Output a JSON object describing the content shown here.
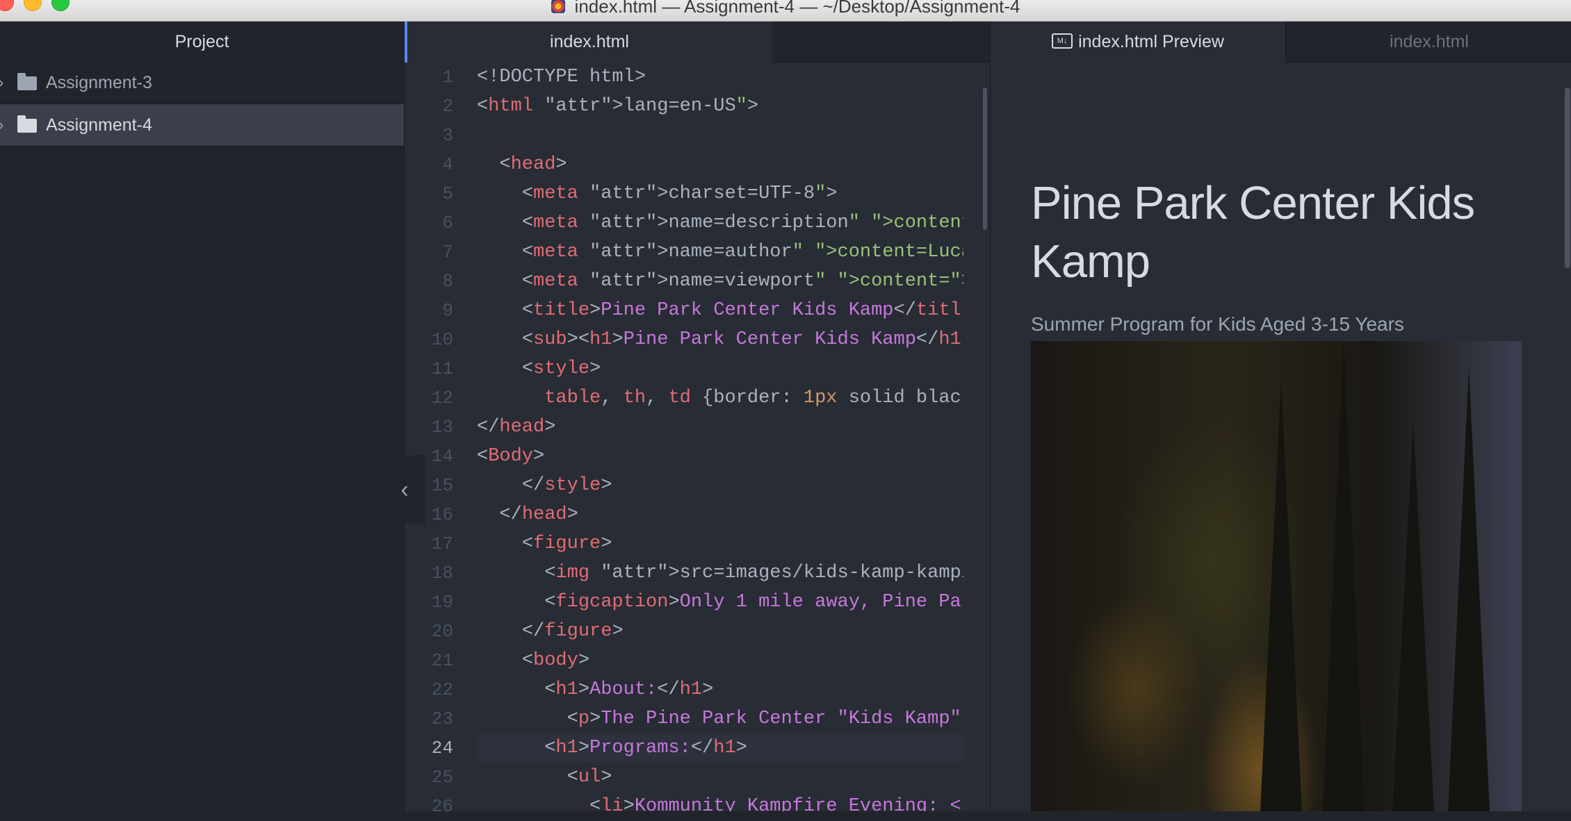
{
  "window": {
    "title": "index.html — Assignment-4 — ~/Desktop/Assignment-4"
  },
  "tree": {
    "header": "Project",
    "items": [
      {
        "label": "Assignment-3",
        "selected": false
      },
      {
        "label": "Assignment-4",
        "selected": true
      }
    ]
  },
  "editor": {
    "tab_label": "index.html",
    "current_line": 24,
    "line_numbers": [
      "1",
      "2",
      "3",
      "4",
      "5",
      "6",
      "7",
      "8",
      "9",
      "10",
      "11",
      "12",
      "13",
      "14",
      "15",
      "16",
      "17",
      "18",
      "19",
      "20",
      "21",
      "22",
      "23",
      "24",
      "25",
      "26"
    ],
    "lines": [
      "<!DOCTYPE html>",
      "<html lang=\"en-US\">",
      "",
      "  <head>",
      "    <meta charset=\"UTF-8\">",
      "    <meta name=\"description\" content=\"Pine",
      "    <meta name=\"author\" content=\"Lucas Hofm",
      "    <meta name=\"viewport\" content=\"width=de",
      "    <title>Pine Park Center Kids Kamp</titl",
      "    <sub><h1>Pine Park Center Kids Kamp</h1",
      "    <style>",
      "      table, th, td {border: 1px solid blac",
      "</head>",
      "<Body>",
      "    </style>",
      "  </head>",
      "    <figure>",
      "      <img src=\"images/kids-kamp-kamping.jp",
      "      <figcaption>Only 1 mile away, Pine Pa",
      "    </figure>",
      "    <body>",
      "      <h1>About:</h1>",
      "        <p>The Pine Park Center \"Kids Kamp\"",
      "      <h1>Programs:</h1>",
      "        <ul>",
      "          <li>Kommunity Kampfire Evening: <"
    ]
  },
  "preview": {
    "tab_label": "index.html Preview",
    "tab_icon": "markdown-icon",
    "other_tab_label": "index.html",
    "heading": "Pine Park Center Kids Kamp",
    "subheading": "Summer Program for Kids Aged 3-15 Years"
  },
  "colors": {
    "tag": "#e06c75",
    "attribute": "#d19a66",
    "string": "#98c379",
    "accent": "#568af2"
  }
}
